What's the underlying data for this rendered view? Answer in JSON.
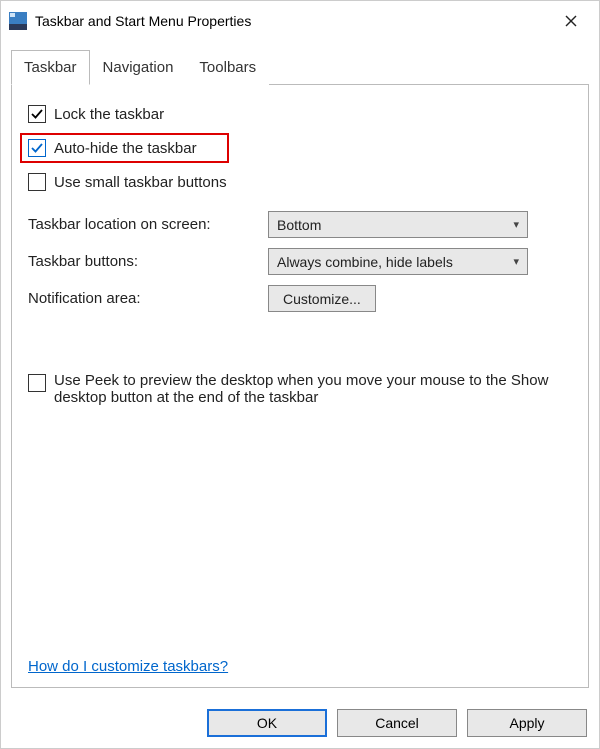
{
  "title": "Taskbar and Start Menu Properties",
  "tabs": {
    "taskbar": "Taskbar",
    "navigation": "Navigation",
    "toolbars": "Toolbars"
  },
  "options": {
    "lock": {
      "label": "Lock the taskbar",
      "checked": true
    },
    "autohide": {
      "label": "Auto-hide the taskbar",
      "checked": true
    },
    "smallbuttons": {
      "label": "Use small taskbar buttons",
      "checked": false
    }
  },
  "settings": {
    "location": {
      "label": "Taskbar location on screen:",
      "value": "Bottom"
    },
    "buttons": {
      "label": "Taskbar buttons:",
      "value": "Always combine, hide labels"
    },
    "notification": {
      "label": "Notification area:",
      "button": "Customize..."
    }
  },
  "peek": {
    "label": "Use Peek to preview the desktop when you move your mouse to the Show desktop button at the end of the taskbar",
    "checked": false
  },
  "help_link": "How do I customize taskbars?",
  "footer": {
    "ok": "OK",
    "cancel": "Cancel",
    "apply": "Apply"
  }
}
